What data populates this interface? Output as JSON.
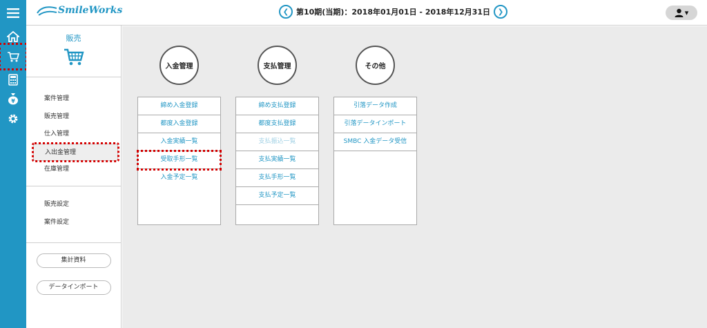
{
  "brand": {
    "name": "SmileWorks",
    "color": "#2196c4"
  },
  "header": {
    "period_text": "第10期(当期)：2018年01月01日 - 2018年12月31日",
    "user_caret": "▾"
  },
  "rail": {
    "icons": [
      "menu-icon",
      "home-icon",
      "cart-icon",
      "calculator-icon",
      "money-bag-icon",
      "gear-icon"
    ]
  },
  "subnav": {
    "title": "販売",
    "items": [
      "案件管理",
      "販売管理",
      "仕入管理",
      "入出金管理",
      "在庫管理"
    ],
    "active_index": 3,
    "settings": [
      "販売設定",
      "案件設定"
    ],
    "buttons": [
      "集計資料",
      "データインポート"
    ]
  },
  "columns": [
    {
      "title": "入金管理",
      "items": [
        "締め入金登録",
        "都度入金登録",
        "入金実績一覧",
        "受取手形一覧",
        "入金予定一覧"
      ]
    },
    {
      "title": "支払管理",
      "items": [
        "締め支払登録",
        "都度支払登録",
        "支払振込一覧",
        "支払実績一覧",
        "支払手形一覧",
        "支払予定一覧"
      ],
      "disabled_index": 2
    },
    {
      "title": "その他",
      "items": [
        "引落データ作成",
        "引落データインポート",
        "SMBC 入金データ受信"
      ]
    }
  ],
  "highlight_color": "#d40000"
}
